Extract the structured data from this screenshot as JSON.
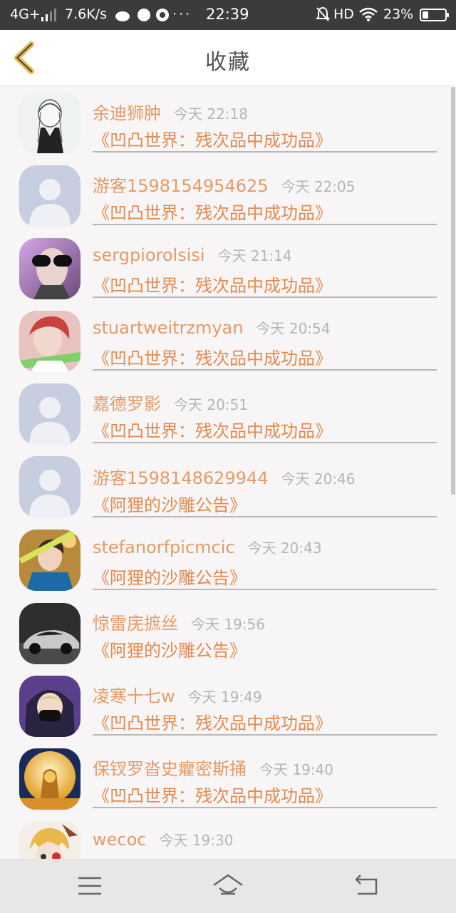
{
  "status_bar": {
    "network": "4G+",
    "speed": "7.6K/s",
    "extra": "···",
    "time": "22:39",
    "hd": "HD",
    "battery": "23%"
  },
  "header": {
    "title": "收藏"
  },
  "items": [
    {
      "name": "余迪狮肿",
      "time": "今天 22:18",
      "title": "《凹凸世界：残次品中成功品》",
      "avatar": "sketch-avatar"
    },
    {
      "name": "游客1598154954625",
      "time": "今天 22:05",
      "title": "《凹凸世界：残次品中成功品》",
      "avatar": "default-avatar"
    },
    {
      "name": "sergpiorolsisi",
      "time": "今天 21:14",
      "title": "《凹凸世界：残次品中成功品》",
      "avatar": "sunglasses-avatar"
    },
    {
      "name": "stuartweitrzmyan",
      "time": "今天 20:54",
      "title": "《凹凸世界：残次品中成功品》",
      "avatar": "redhair-avatar"
    },
    {
      "name": "嘉德罗影",
      "time": "今天 20:51",
      "title": "《凹凸世界：残次品中成功品》",
      "avatar": "default-avatar"
    },
    {
      "name": "游客1598148629944",
      "time": "今天 20:46",
      "title": "《阿狸的沙雕公告》",
      "avatar": "default-avatar"
    },
    {
      "name": "stefanorfpicmcic",
      "time": "今天 20:43",
      "title": "《阿狸的沙雕公告》",
      "avatar": "boy-avatar"
    },
    {
      "name": "惊雷庑摭丝",
      "time": "今天 19:56",
      "title": "《阿狸的沙雕公告》",
      "avatar": "car-avatar"
    },
    {
      "name": "凌寒十七w",
      "time": "今天 19:49",
      "title": "《凹凸世界：残次品中成功品》",
      "avatar": "masked-avatar"
    },
    {
      "name": "保钗罗沓史癯密斯捅",
      "time": "今天 19:40",
      "title": "《凹凸世界：残次品中成功品》",
      "avatar": "buddha-avatar"
    },
    {
      "name": "wecoc",
      "time": "今天 19:30",
      "title": "",
      "avatar": "anime-avatar"
    }
  ],
  "nav": {
    "menu": "menu-icon",
    "home": "home-icon",
    "back": "back-icon"
  },
  "colors": {
    "name": "#e59b66",
    "title": "#e48a4c",
    "time": "#b5b5b5",
    "accent": "#e5b54a"
  }
}
